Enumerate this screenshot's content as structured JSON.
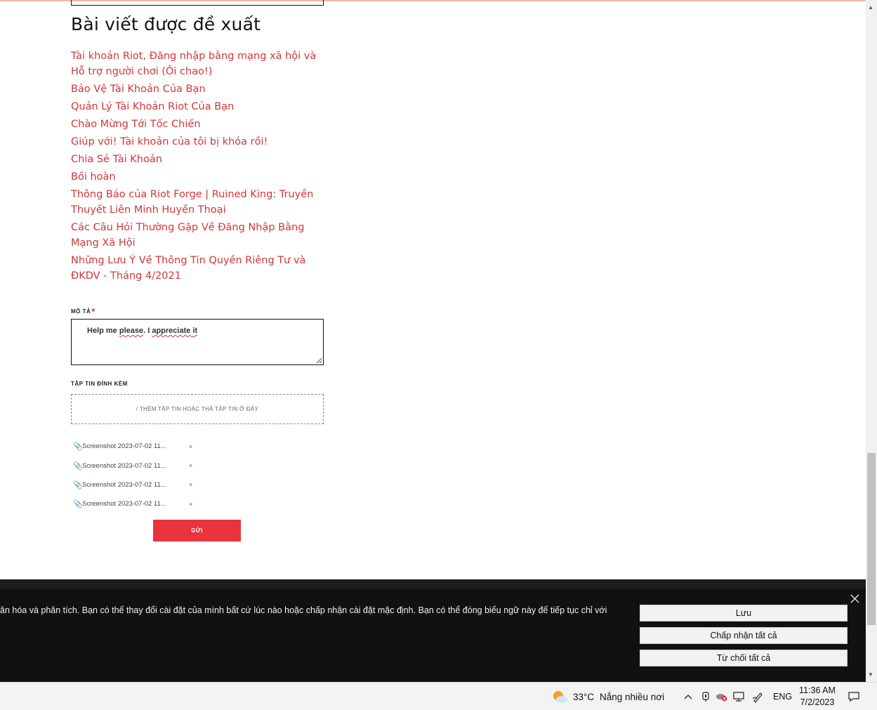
{
  "suggested": {
    "title": "Bài viết được đề xuất",
    "articles": [
      {
        "label": "Tài khoản Riot, Đăng nhập bằng mạng xã hội và Hỗ trợ người chơi (Ôi chao!)"
      },
      {
        "label": "Bảo Vệ Tài Khoản Của Bạn"
      },
      {
        "label": "Quản Lý Tài Khoản Riot Của Bạn"
      },
      {
        "label": "Chào Mừng Tới Tốc Chiến"
      },
      {
        "label": "Giúp với! Tài khoản của tôi bị khóa rồi!"
      },
      {
        "label": "Chia Sẻ Tài Khoản"
      },
      {
        "label": "Bồi hoàn"
      },
      {
        "label": "Thông Báo của Riot Forge | Ruined King: Truyền Thuyết Liên Minh Huyền Thoại"
      },
      {
        "label": "Các Câu Hỏi Thường Gặp Về Đăng Nhập Bằng Mạng Xã Hội"
      },
      {
        "label": "Những Lưu Ý Về Thông Tin Quyền Riêng Tư và ĐKDV - Tháng 4/2021"
      }
    ]
  },
  "form": {
    "description_label": "MÔ TẢ",
    "required_mark": "*",
    "description_value": {
      "part1": "Help me ",
      "part2": "please",
      "part3": ". I ",
      "part4": "appreciate",
      "part5": " ",
      "part6": "it"
    },
    "attachments_label": "TẬP TIN ĐÍNH KÈM",
    "dropzone_text": "/ THÊM TẬP TIN HOẶC THẢ TẬP TIN Ở ĐÂY",
    "files": [
      {
        "name": "Screenshot 2023-07-02 11...",
        "remove": "×"
      },
      {
        "name": "Screenshot 2023-07-02 11...",
        "remove": "×"
      },
      {
        "name": "Screenshot 2023-07-02 11...",
        "remove": "×"
      },
      {
        "name": "Screenshot 2023-07-02 11...",
        "remove": "×"
      }
    ],
    "submit_label": "GỬI"
  },
  "cookie_banner": {
    "text": "ân hóa và phân tích. Bạn có thể thay đổi cài đặt của mình bất cứ lúc nào hoặc chấp nhận cài đặt mặc định. Bạn có thể đóng biểu ngữ này để tiếp tục chỉ với",
    "save_label": "Lưu",
    "accept_all_label": "Chấp nhận tất cả",
    "reject_all_label": "Từ chối tất cả"
  },
  "taskbar": {
    "temperature": "33°C",
    "weather": "Nắng nhiều nơi",
    "language": "ENG",
    "time": "11:36 AM",
    "date": "7/2/2023"
  },
  "colors": {
    "link": "#d13639",
    "submit_button": "#e8343a",
    "banner_bg": "#111111",
    "taskbar_bg": "#f3f3f3"
  },
  "icons": [
    "paperclip-icon",
    "close-icon",
    "weather-partly-sunny-icon",
    "chevron-up-icon",
    "meet-now-icon",
    "onedrive-error-icon",
    "network-icon",
    "pen-icon",
    "notification-icon"
  ]
}
